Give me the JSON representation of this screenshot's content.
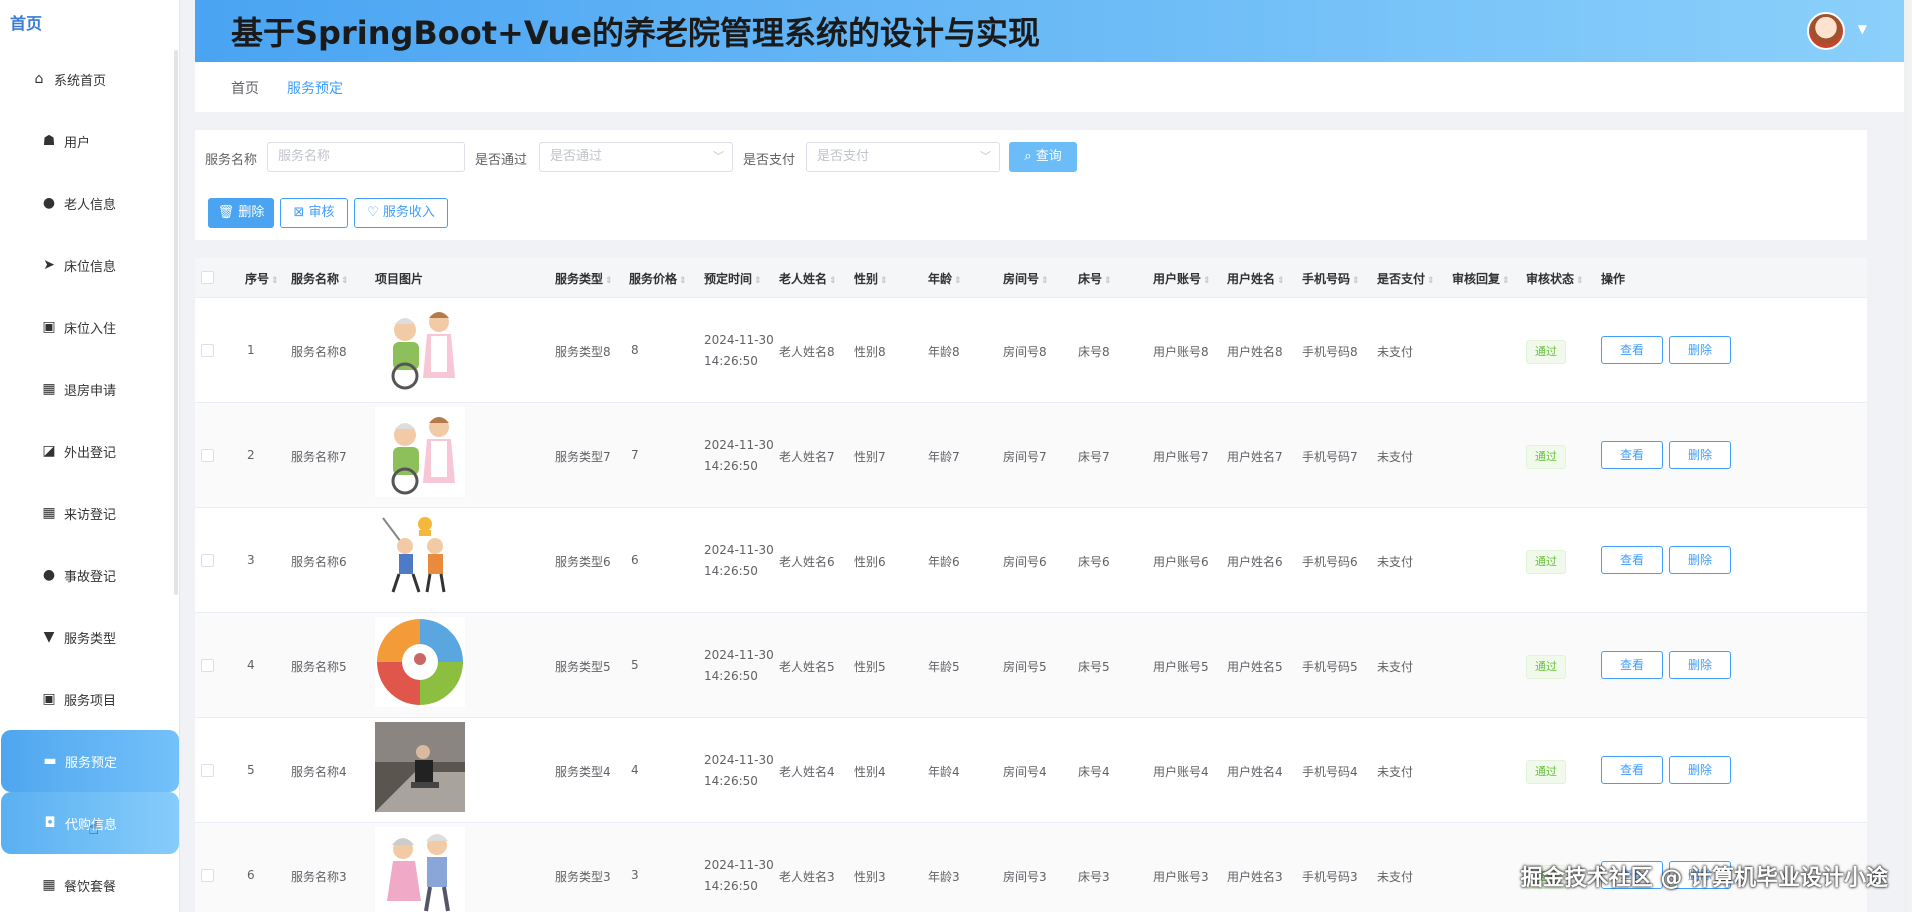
{
  "app": {
    "logo": "首页",
    "title": "基于SpringBoot+Vue的养老院管理系统的设计与实现"
  },
  "sidebar": {
    "items": [
      {
        "label": "系统首页",
        "icon": "home-icon"
      },
      {
        "label": "用户",
        "icon": "user-group-icon"
      },
      {
        "label": "老人信息",
        "icon": "person-icon"
      },
      {
        "label": "床位信息",
        "icon": "send-icon"
      },
      {
        "label": "床位入住",
        "icon": "clipboard-icon"
      },
      {
        "label": "退房申请",
        "icon": "grid-icon"
      },
      {
        "label": "外出登记",
        "icon": "chart-icon"
      },
      {
        "label": "来访登记",
        "icon": "grid-icon"
      },
      {
        "label": "事故登记",
        "icon": "person-icon"
      },
      {
        "label": "服务类型",
        "icon": "type-icon"
      },
      {
        "label": "服务项目",
        "icon": "clipboard-icon"
      },
      {
        "label": "服务预定",
        "icon": "ticket-icon"
      },
      {
        "label": "代购信息",
        "icon": "briefcase-icon"
      },
      {
        "label": "餐饮套餐",
        "icon": "grid-icon"
      }
    ]
  },
  "breadcrumb": {
    "home": "首页",
    "current": "服务预定"
  },
  "search": {
    "name_label": "服务名称",
    "name_placeholder": "服务名称",
    "pass_label": "是否通过",
    "pass_placeholder": "是否通过",
    "pay_label": "是否支付",
    "pay_placeholder": "是否支付",
    "search_button": "查询"
  },
  "actions": {
    "delete": "删除",
    "audit": "审核",
    "income": "服务收入"
  },
  "table": {
    "headers": [
      "序号",
      "服务名称",
      "项目图片",
      "服务类型",
      "服务价格",
      "预定时间",
      "老人姓名",
      "性别",
      "年龄",
      "房间号",
      "床号",
      "用户账号",
      "用户姓名",
      "手机号码",
      "是否支付",
      "审核回复",
      "审核状态",
      "操作"
    ],
    "rows": [
      {
        "no": "1",
        "name": "服务名称8",
        "type": "服务类型8",
        "price": "8",
        "date": "2024-11-30",
        "time": "14:26:50",
        "elder": "老人姓名8",
        "gender": "性别8",
        "age": "年龄8",
        "room": "房间号8",
        "bed": "床号8",
        "account": "用户账号8",
        "username": "用户姓名8",
        "phone": "手机号码8",
        "paid": "未支付",
        "status": "通过",
        "view": "查看",
        "del": "删除"
      },
      {
        "no": "2",
        "name": "服务名称7",
        "type": "服务类型7",
        "price": "7",
        "date": "2024-11-30",
        "time": "14:26:50",
        "elder": "老人姓名7",
        "gender": "性别7",
        "age": "年龄7",
        "room": "房间号7",
        "bed": "床号7",
        "account": "用户账号7",
        "username": "用户姓名7",
        "phone": "手机号码7",
        "paid": "未支付",
        "status": "通过",
        "view": "查看",
        "del": "删除"
      },
      {
        "no": "3",
        "name": "服务名称6",
        "type": "服务类型6",
        "price": "6",
        "date": "2024-11-30",
        "time": "14:26:50",
        "elder": "老人姓名6",
        "gender": "性别6",
        "age": "年龄6",
        "room": "房间号6",
        "bed": "床号6",
        "account": "用户账号6",
        "username": "用户姓名6",
        "phone": "手机号码6",
        "paid": "未支付",
        "status": "通过",
        "view": "查看",
        "del": "删除"
      },
      {
        "no": "4",
        "name": "服务名称5",
        "type": "服务类型5",
        "price": "5",
        "date": "2024-11-30",
        "time": "14:26:50",
        "elder": "老人姓名5",
        "gender": "性别5",
        "age": "年龄5",
        "room": "房间号5",
        "bed": "床号5",
        "account": "用户账号5",
        "username": "用户姓名5",
        "phone": "手机号码5",
        "paid": "未支付",
        "status": "通过",
        "view": "查看",
        "del": "删除"
      },
      {
        "no": "5",
        "name": "服务名称4",
        "type": "服务类型4",
        "price": "4",
        "date": "2024-11-30",
        "time": "14:26:50",
        "elder": "老人姓名4",
        "gender": "性别4",
        "age": "年龄4",
        "room": "房间号4",
        "bed": "床号4",
        "account": "用户账号4",
        "username": "用户姓名4",
        "phone": "手机号码4",
        "paid": "未支付",
        "status": "通过",
        "view": "查看",
        "del": "删除"
      },
      {
        "no": "6",
        "name": "服务名称3",
        "type": "服务类型3",
        "price": "3",
        "date": "2024-11-30",
        "time": "14:26:50",
        "elder": "老人姓名3",
        "gender": "性别3",
        "age": "年龄3",
        "room": "房间号3",
        "bed": "床号3",
        "account": "用户账号3",
        "username": "用户姓名3",
        "phone": "手机号码3",
        "paid": "未支付",
        "status": "通过",
        "view": "查看",
        "del": "删除"
      }
    ]
  },
  "watermark": "掘金技术社区 @ 计算机毕业设计小途",
  "colors": {
    "accent": "#409eff",
    "header_start": "#4aa4f2",
    "header_end": "#8bd0fb",
    "tag_green": "#67c23a"
  }
}
